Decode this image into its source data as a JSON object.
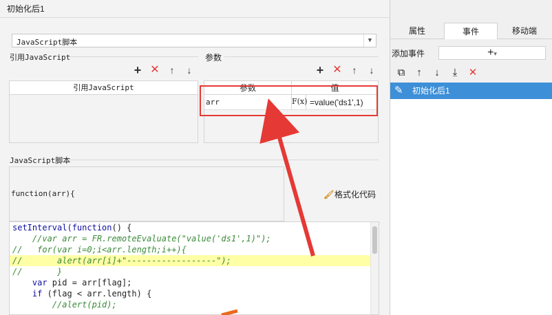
{
  "dialog": {
    "title": "初始化后1",
    "type_select": "JavaScript脚本"
  },
  "ref_section": {
    "label": "引用JavaScript",
    "column_header": "引用JavaScript"
  },
  "param_section": {
    "label": "参数",
    "columns": [
      "参数",
      "值"
    ],
    "rows": [
      {
        "name": "arr",
        "formula_icon": "F(x)",
        "value": "=value('ds1',1)"
      }
    ]
  },
  "script_section": {
    "label": "JavaScript脚本",
    "function_header": "function(arr){",
    "format_button": "格式化代码"
  },
  "code_lines": [
    {
      "parts": [
        [
          "kw",
          "setInterval("
        ],
        [
          "kw",
          "function"
        ],
        [
          "pl",
          "() {"
        ]
      ]
    },
    {
      "parts": [
        [
          "cm",
          "    //var arr = FR.remoteEvaluate(\"value('ds1',1)\");"
        ]
      ]
    },
    {
      "parts": [
        [
          "cm",
          "//   for(var i=0;i<arr.length;i++){"
        ]
      ]
    },
    {
      "parts": [
        [
          "cm",
          "//       alert(arr[i]+\"------------------\");"
        ]
      ],
      "highlight": true
    },
    {
      "parts": [
        [
          "cm",
          "//       }"
        ]
      ]
    },
    {
      "parts": [
        [
          "kw",
          "    var "
        ],
        [
          "pl",
          "pid = arr[flag];"
        ]
      ]
    },
    {
      "parts": [
        [
          "kw",
          "    if "
        ],
        [
          "pl",
          "(flag < arr.length) {"
        ]
      ]
    },
    {
      "parts": [
        [
          "cm",
          "        //alert(pid);"
        ]
      ]
    }
  ],
  "right_pane": {
    "tabs": [
      "属性",
      "事件",
      "移动端"
    ],
    "active_tab": 1,
    "add_event_label": "添加事件",
    "add_event_button": "+",
    "event_items": [
      "初始化后1"
    ]
  },
  "colors": {
    "highlight_border": "#e53935",
    "selected_event_bg": "#3d8fd8",
    "code_keyword": "#1010a0",
    "code_comment": "#3a8a3a",
    "line_highlight": "#ffffa6"
  }
}
